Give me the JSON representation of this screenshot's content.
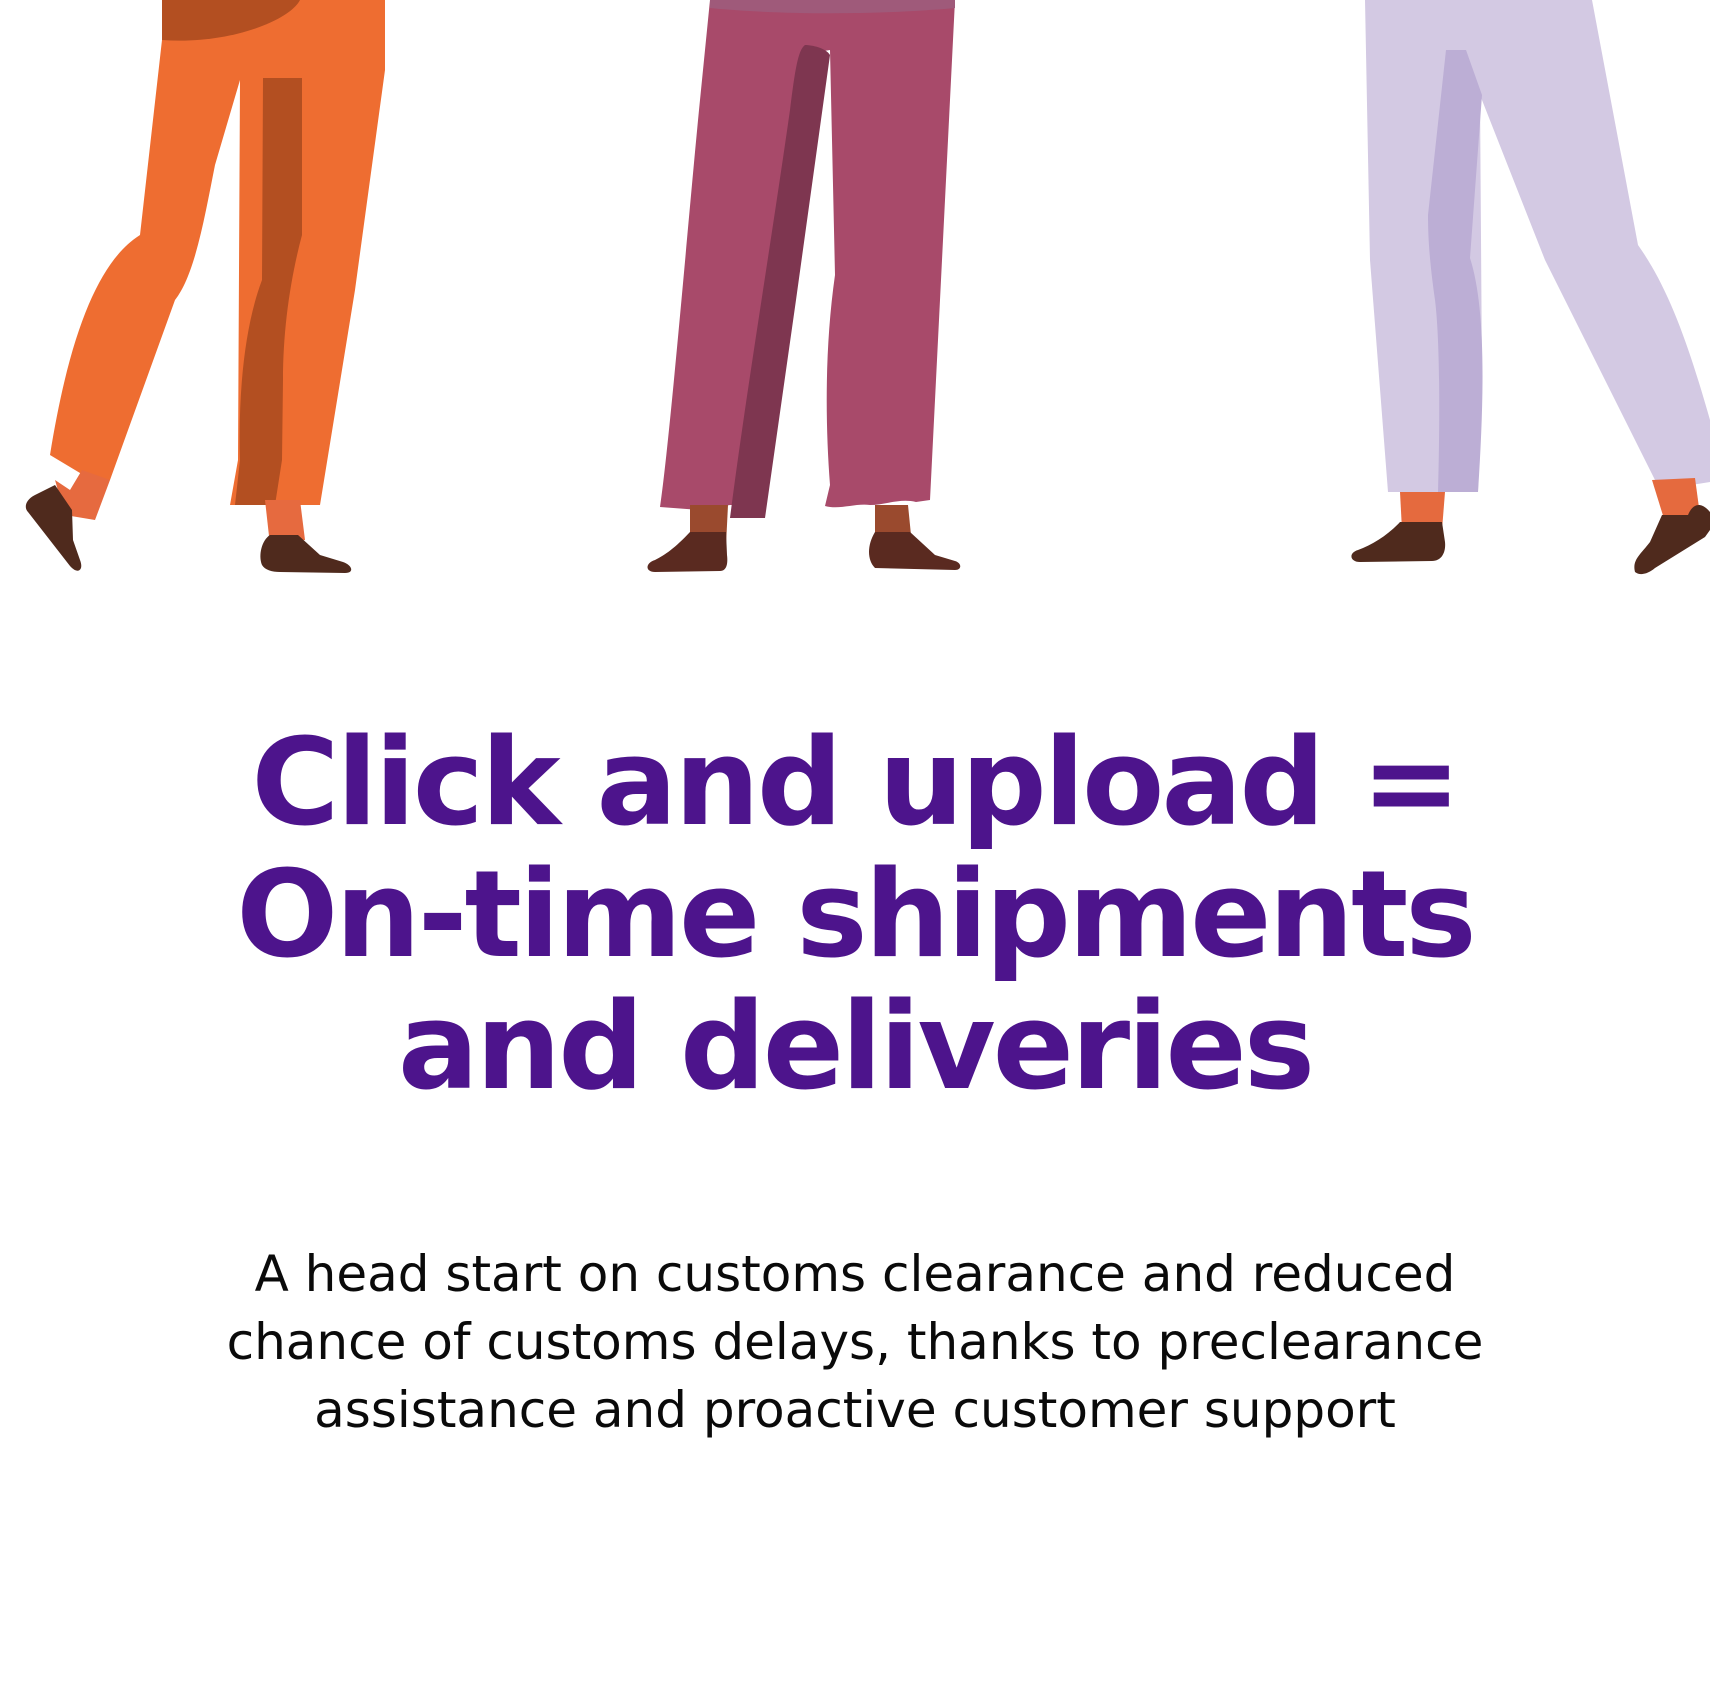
{
  "illustration": {
    "figures": [
      {
        "name": "figure-orange-pants",
        "pants_color": "#ee6d31",
        "shadow_color": "#b34f21",
        "shoe_color": "#4f2a1d",
        "skin_color": "#e66a3f"
      },
      {
        "name": "figure-magenta-pants",
        "pants_color": "#a84a6a",
        "shadow_color": "#7e3650",
        "shoe_color": "#5a2a20",
        "skin_color": "#9a4a2e"
      },
      {
        "name": "figure-lavender-pants",
        "pants_color": "#d3c9e3",
        "shadow_color": "#bcaed5",
        "shoe_color": "#4f2a1d",
        "skin_color": "#e56a3e"
      }
    ]
  },
  "headline": {
    "lines": [
      "Click and upload =",
      "On-time shipments",
      "and deliveries"
    ],
    "color": "#4d148c"
  },
  "subtext": {
    "lines": [
      "A head start on customs clearance and reduced",
      "chance of customs delays, thanks to preclearance",
      "assistance and proactive customer support"
    ]
  }
}
